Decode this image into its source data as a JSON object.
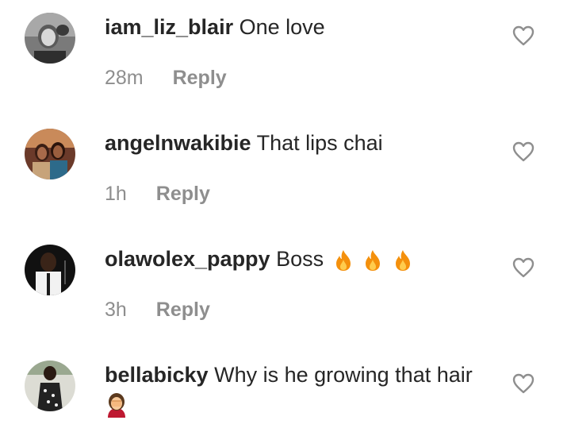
{
  "comments": [
    {
      "username": "iam_liz_blair",
      "text": "One love",
      "time": "28m",
      "reply_label": "Reply",
      "emojis": [],
      "avatar_icon": "profile-photo-woman"
    },
    {
      "username": "angelnwakibie",
      "text": "That lips chai",
      "time": "1h",
      "reply_label": "Reply",
      "emojis": [],
      "avatar_icon": "profile-photo-group"
    },
    {
      "username": "olawolex_pappy",
      "text": "Boss",
      "time": "3h",
      "reply_label": "Reply",
      "emojis": [
        "fire",
        "fire",
        "fire"
      ],
      "avatar_icon": "profile-photo-man"
    },
    {
      "username": "bellabicky",
      "text": "Why is he growing that hair",
      "time": "",
      "reply_label": "",
      "emojis": [
        "woman-facepalming"
      ],
      "avatar_icon": "profile-photo-woman-dress"
    }
  ],
  "colors": {
    "text": "#262626",
    "meta": "#8e8e8e",
    "heart_stroke": "#8e8e8e",
    "fire": "#f4900c",
    "fire_inner": "#ffcc4d",
    "facepalm_shirt": "#be1931"
  }
}
